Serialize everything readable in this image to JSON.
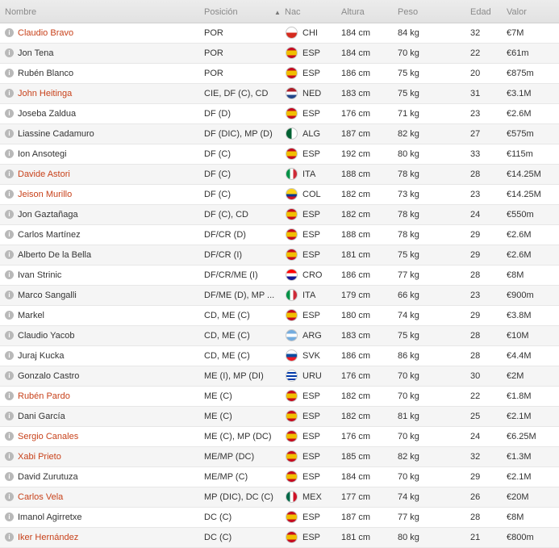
{
  "header": {
    "name": "Nombre",
    "position": "Posición",
    "nationality": "Nac",
    "height": "Altura",
    "weight": "Peso",
    "age": "Edad",
    "value": "Valor"
  },
  "flag_styles": {
    "CHI": "linear-gradient(#ffffff 0 50%, #d52b1e 50% 100%)",
    "ESP": "linear-gradient(#c60b1e 0 28%, #f1bf00 28% 72%, #c60b1e 72% 100%)",
    "NED": "linear-gradient(#ae1c28 0 33%, #ffffff 33% 66%, #21468b 66% 100%)",
    "ALG": "linear-gradient(90deg, #006233 0 50%, #ffffff 50% 100%)",
    "ITA": "linear-gradient(90deg, #009246 0 33%, #ffffff 33% 66%, #ce2b37 66% 100%)",
    "COL": "linear-gradient(#fcd116 0 50%, #003893 50% 75%, #ce1126 75% 100%)",
    "CRO": "linear-gradient(#ff0000 0 33%, #ffffff 33% 66%, #171796 66% 100%)",
    "ARG": "linear-gradient(#74acdf 0 33%, #ffffff 33% 66%, #74acdf 66% 100%)",
    "SVK": "linear-gradient(#ffffff 0 33%, #0b4ea2 33% 66%, #ee1c25 66% 100%)",
    "URU": "repeating-linear-gradient(#ffffff 0 2px, #0038a8 2px 4px)",
    "MEX": "linear-gradient(90deg, #006847 0 33%, #ffffff 33% 66%, #ce1126 66% 100%)"
  },
  "players": [
    {
      "name": "Claudio Bravo",
      "highlight": true,
      "position": "POR",
      "nat": "CHI",
      "height": "184 cm",
      "weight": "84 kg",
      "age": "32",
      "value": "€7M"
    },
    {
      "name": "Jon Tena",
      "highlight": false,
      "position": "POR",
      "nat": "ESP",
      "height": "184 cm",
      "weight": "70 kg",
      "age": "22",
      "value": "€61m"
    },
    {
      "name": "Rubén Blanco",
      "highlight": false,
      "position": "POR",
      "nat": "ESP",
      "height": "186 cm",
      "weight": "75 kg",
      "age": "20",
      "value": "€875m"
    },
    {
      "name": "John Heitinga",
      "highlight": true,
      "position": "CIE, DF (C), CD",
      "nat": "NED",
      "height": "183 cm",
      "weight": "75 kg",
      "age": "31",
      "value": "€3.1M"
    },
    {
      "name": "Joseba Zaldua",
      "highlight": false,
      "position": "DF (D)",
      "nat": "ESP",
      "height": "176 cm",
      "weight": "71 kg",
      "age": "23",
      "value": "€2.6M"
    },
    {
      "name": "Liassine Cadamuro",
      "highlight": false,
      "position": "DF (DIC), MP (D)",
      "nat": "ALG",
      "height": "187 cm",
      "weight": "82 kg",
      "age": "27",
      "value": "€575m"
    },
    {
      "name": "Ion Ansotegi",
      "highlight": false,
      "position": "DF (C)",
      "nat": "ESP",
      "height": "192 cm",
      "weight": "80 kg",
      "age": "33",
      "value": "€115m"
    },
    {
      "name": "Davide Astori",
      "highlight": true,
      "position": "DF (C)",
      "nat": "ITA",
      "height": "188 cm",
      "weight": "78 kg",
      "age": "28",
      "value": "€14.25M"
    },
    {
      "name": "Jeison Murillo",
      "highlight": true,
      "position": "DF (C)",
      "nat": "COL",
      "height": "182 cm",
      "weight": "73 kg",
      "age": "23",
      "value": "€14.25M"
    },
    {
      "name": "Jon Gaztañaga",
      "highlight": false,
      "position": "DF (C), CD",
      "nat": "ESP",
      "height": "182 cm",
      "weight": "78 kg",
      "age": "24",
      "value": "€550m"
    },
    {
      "name": "Carlos Martínez",
      "highlight": false,
      "position": "DF/CR (D)",
      "nat": "ESP",
      "height": "188 cm",
      "weight": "78 kg",
      "age": "29",
      "value": "€2.6M"
    },
    {
      "name": "Alberto De la Bella",
      "highlight": false,
      "position": "DF/CR (I)",
      "nat": "ESP",
      "height": "181 cm",
      "weight": "75 kg",
      "age": "29",
      "value": "€2.6M"
    },
    {
      "name": "Ivan Strinic",
      "highlight": false,
      "position": "DF/CR/ME (I)",
      "nat": "CRO",
      "height": "186 cm",
      "weight": "77 kg",
      "age": "28",
      "value": "€8M"
    },
    {
      "name": "Marco Sangalli",
      "highlight": false,
      "position": "DF/ME (D), MP ...",
      "nat": "ITA",
      "height": "179 cm",
      "weight": "66 kg",
      "age": "23",
      "value": "€900m"
    },
    {
      "name": "Markel",
      "highlight": false,
      "position": "CD, ME (C)",
      "nat": "ESP",
      "height": "180 cm",
      "weight": "74 kg",
      "age": "29",
      "value": "€3.8M"
    },
    {
      "name": "Claudio Yacob",
      "highlight": false,
      "position": "CD, ME (C)",
      "nat": "ARG",
      "height": "183 cm",
      "weight": "75 kg",
      "age": "28",
      "value": "€10M"
    },
    {
      "name": "Juraj Kucka",
      "highlight": false,
      "position": "CD, ME (C)",
      "nat": "SVK",
      "height": "186 cm",
      "weight": "86 kg",
      "age": "28",
      "value": "€4.4M"
    },
    {
      "name": "Gonzalo Castro",
      "highlight": false,
      "position": "ME (I), MP (DI)",
      "nat": "URU",
      "height": "176 cm",
      "weight": "70 kg",
      "age": "30",
      "value": "€2M"
    },
    {
      "name": "Rubén Pardo",
      "highlight": true,
      "position": "ME (C)",
      "nat": "ESP",
      "height": "182 cm",
      "weight": "70 kg",
      "age": "22",
      "value": "€1.8M"
    },
    {
      "name": "Dani García",
      "highlight": false,
      "position": "ME (C)",
      "nat": "ESP",
      "height": "182 cm",
      "weight": "81 kg",
      "age": "25",
      "value": "€2.1M"
    },
    {
      "name": "Sergio Canales",
      "highlight": true,
      "position": "ME (C), MP (DC)",
      "nat": "ESP",
      "height": "176 cm",
      "weight": "70 kg",
      "age": "24",
      "value": "€6.25M"
    },
    {
      "name": "Xabi Prieto",
      "highlight": true,
      "position": "ME/MP (DC)",
      "nat": "ESP",
      "height": "185 cm",
      "weight": "82 kg",
      "age": "32",
      "value": "€1.3M"
    },
    {
      "name": "David Zurutuza",
      "highlight": false,
      "position": "ME/MP (C)",
      "nat": "ESP",
      "height": "184 cm",
      "weight": "70 kg",
      "age": "29",
      "value": "€2.1M"
    },
    {
      "name": "Carlos Vela",
      "highlight": true,
      "position": "MP (DIC), DC (C)",
      "nat": "MEX",
      "height": "177 cm",
      "weight": "74 kg",
      "age": "26",
      "value": "€20M"
    },
    {
      "name": "Imanol Agirretxe",
      "highlight": false,
      "position": "DC (C)",
      "nat": "ESP",
      "height": "187 cm",
      "weight": "77 kg",
      "age": "28",
      "value": "€8M"
    },
    {
      "name": "Iker Hernández",
      "highlight": true,
      "position": "DC (C)",
      "nat": "ESP",
      "height": "181 cm",
      "weight": "80 kg",
      "age": "21",
      "value": "€800m"
    }
  ]
}
